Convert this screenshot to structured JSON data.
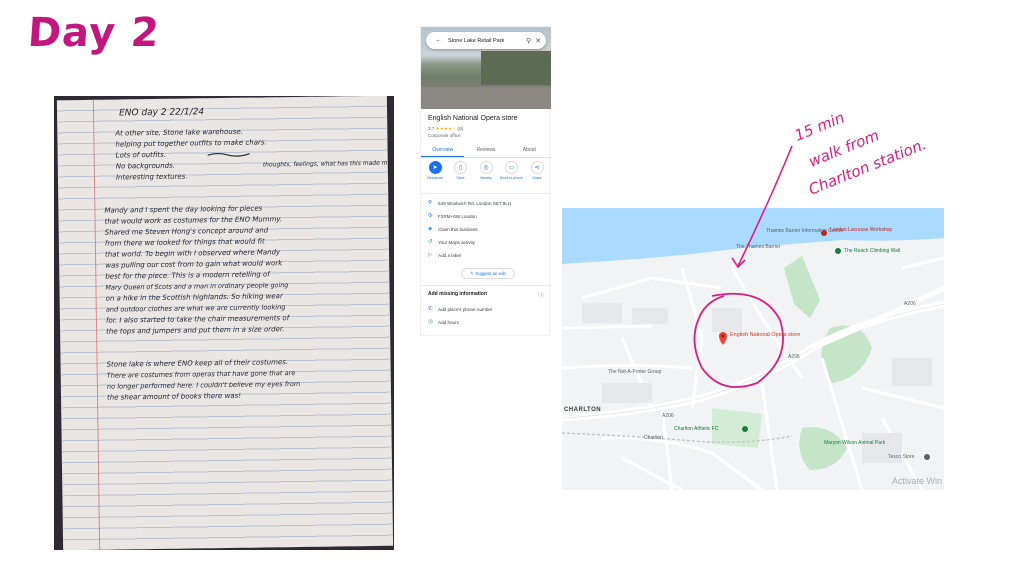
{
  "slide": {
    "title": "Day 2"
  },
  "notebook": {
    "heading": "ENO day 2   22/1/24",
    "bullets": [
      "At other site, Stone lake warehouse.",
      "helping put together outfits to make chars.",
      "Lots of outfits.",
      "No backgrounds.",
      "Interesting textures."
    ],
    "side_note": "thoughts, feelings, what has this made me think",
    "paragraph1": [
      "Mandy and I spent the day looking for pieces",
      "that would work as costumes for the ENO Mummy.",
      "Shared me Steven Hong's concept around and",
      "from there we looked for things that would fit",
      "that world. To begin with I observed where Mandy",
      "was pulling our cost from to gain what would work",
      "best for the piece. This is a modern retelling of",
      "Mary Queen of Scots and a man in ordinary people going",
      "on a hike in the Scottish highlands. So hiking wear",
      "and outdoor clothes are what we are currently looking",
      "for. I also started to take the chair measurements of",
      "the tops and jumpers and put them in a size order."
    ],
    "paragraph2": [
      "Stone lake is where ENO keep all of their costumes.",
      "There are costumes from operas that have gone that are",
      "no longer performed here. I couldn't believe my eyes from",
      "the shear amount of books there was!"
    ]
  },
  "place_card": {
    "search_text": "Stone Lake Retail Park",
    "name": "English National Opera store",
    "rating": "3.7",
    "stars": "★★★★☆",
    "review_count": "(8)",
    "category": "Corporate office",
    "tabs": [
      "Overview",
      "Reviews",
      "About"
    ],
    "actions": [
      {
        "label": "Directions",
        "icon": "directions-icon",
        "glyph": "➤"
      },
      {
        "label": "Save",
        "icon": "bookmark-icon",
        "glyph": "▯"
      },
      {
        "label": "Nearby",
        "icon": "nearby-icon",
        "glyph": "◎"
      },
      {
        "label": "Send to phone",
        "icon": "phone-icon",
        "glyph": "▭"
      },
      {
        "label": "Share",
        "icon": "share-icon",
        "glyph": "⋖"
      }
    ],
    "details": [
      {
        "text": "649 Woolwich Rd, London SE7 8LH",
        "icon": "location-pin-icon",
        "glyph": "⚲"
      },
      {
        "text": "F2RM+6W London",
        "icon": "plus-code-icon",
        "glyph": "✣"
      },
      {
        "text": "Claim this business",
        "icon": "shield-check-icon",
        "glyph": "◈"
      },
      {
        "text": "Your Maps activity",
        "icon": "history-icon",
        "glyph": "↺"
      },
      {
        "text": "Add a label",
        "icon": "label-icon",
        "glyph": "▷"
      }
    ],
    "suggest_edit": "Suggest an edit",
    "missing_info_title": "Add missing information",
    "missing": [
      {
        "text": "Add place's phone number",
        "icon": "phone-call-icon",
        "glyph": "✆"
      },
      {
        "text": "Add hours",
        "icon": "clock-icon",
        "glyph": "◷"
      }
    ]
  },
  "map": {
    "pin_label": "English National Opera store",
    "labels": [
      {
        "text": "The Thames Barrier",
        "style": "normal"
      },
      {
        "text": "Thames Barrier Information Centre",
        "style": "normal"
      },
      {
        "text": "London Lacrosse Workshop",
        "style": "pink"
      },
      {
        "text": "The Reach Climbing Wall",
        "style": "green"
      },
      {
        "text": "The Net-A-Porter Group",
        "style": "normal"
      },
      {
        "text": "CHARLTON",
        "style": "bold"
      },
      {
        "text": "Charlton",
        "style": "normal"
      },
      {
        "text": "Charlton Athletic FC",
        "style": "green"
      },
      {
        "text": "Maryon Wilson Animal Park",
        "style": "green"
      },
      {
        "text": "Tesco Store",
        "style": "normal"
      },
      {
        "text": "A206",
        "style": "normal"
      },
      {
        "text": "A206",
        "style": "normal"
      },
      {
        "text": "A206",
        "style": "normal"
      }
    ],
    "watermark": "Activate Win"
  },
  "annotation": {
    "lines": [
      "15 min",
      "walk from",
      "Charlton station."
    ]
  }
}
